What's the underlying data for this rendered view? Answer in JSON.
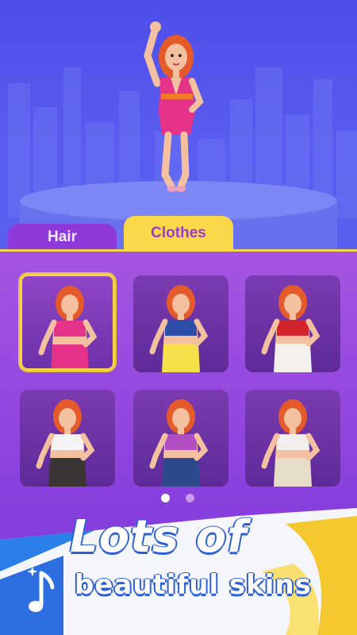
{
  "tabs": {
    "hair_label": "Hair",
    "clothes_label": "Clothes",
    "active": "Clothes"
  },
  "outfits": [
    {
      "name": "pink-wrap-dress",
      "top_color": "#e6338a",
      "bottom_color": "#e6338a",
      "selected": true
    },
    {
      "name": "blue-crop-yellow-pants",
      "top_color": "#2d4fa8",
      "bottom_color": "#f5e04a",
      "selected": false
    },
    {
      "name": "red-bikini-white-skirt",
      "top_color": "#d3242c",
      "bottom_color": "#f4f1ec",
      "selected": false
    },
    {
      "name": "white-blouse-dark-shorts",
      "top_color": "#f6f3f7",
      "bottom_color": "#3b3435",
      "selected": false
    },
    {
      "name": "purple-top-denim-skirt",
      "top_color": "#b24dc2",
      "bottom_color": "#2d4a8c",
      "selected": false
    },
    {
      "name": "lace-top-beige-pants",
      "top_color": "#f1eeee",
      "bottom_color": "#e6dcc8",
      "selected": false
    }
  ],
  "pagination": {
    "pages": 2,
    "current": 1
  },
  "banner": {
    "line1": "Lots of",
    "line2": "beautiful skins"
  },
  "colors": {
    "accent_yellow": "#f9d94a",
    "panel_purple": "#8b41de",
    "stage_blue": "#5a5df0",
    "hair": "#e55a2a",
    "skin": "#f3c0a0"
  }
}
